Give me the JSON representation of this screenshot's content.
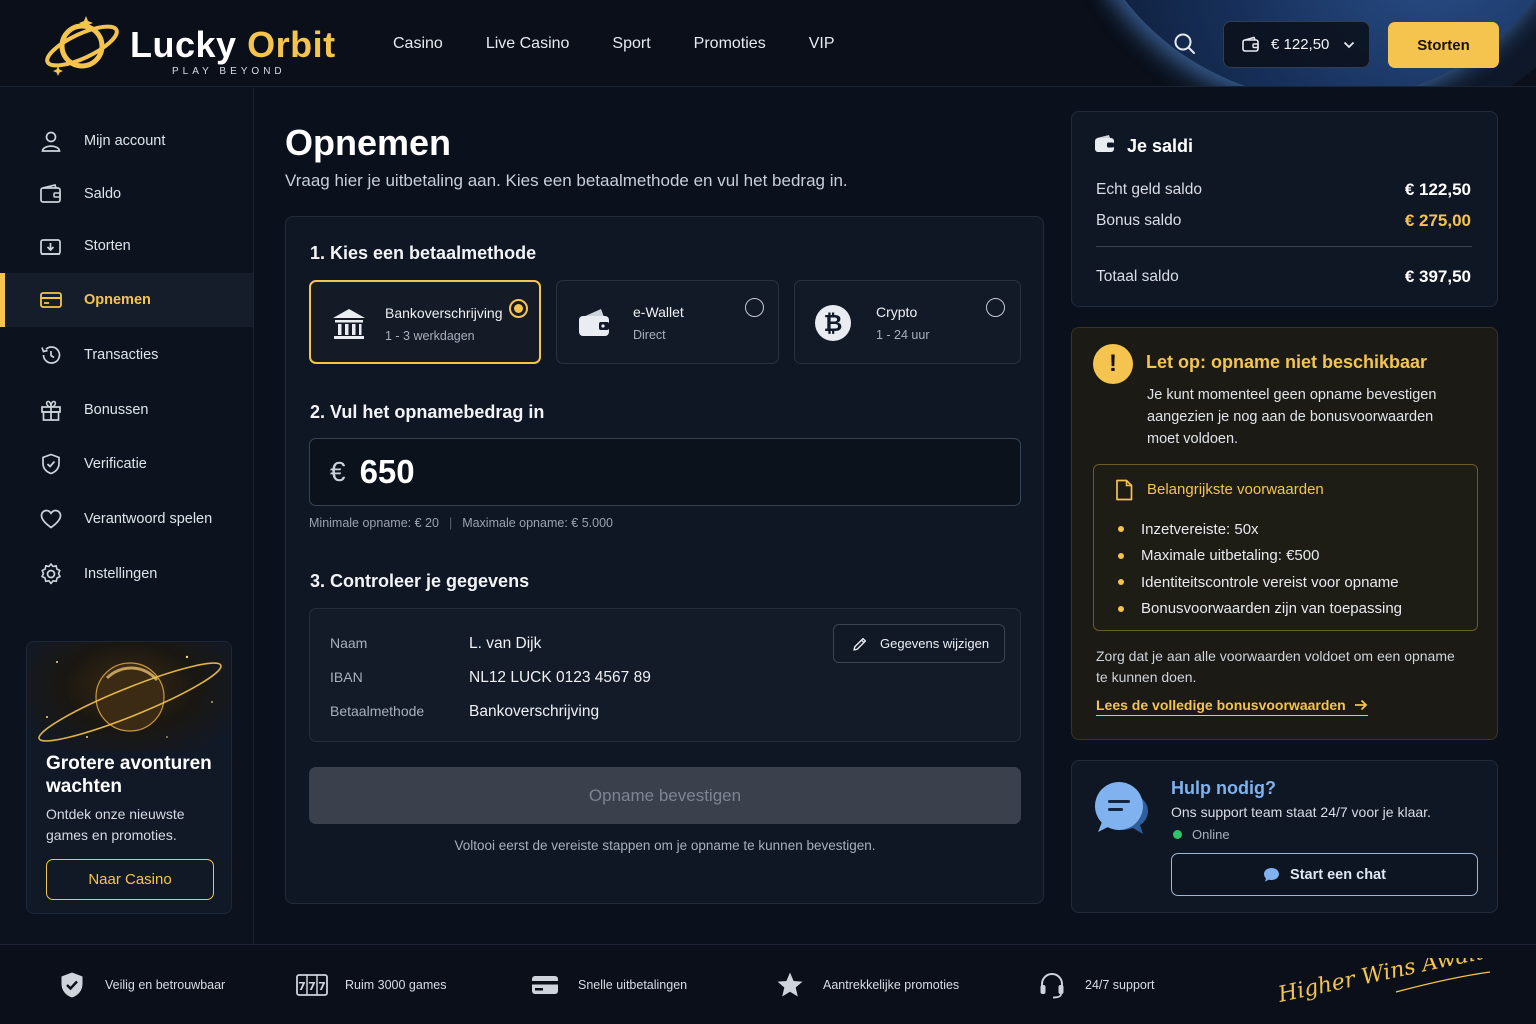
{
  "brand": {
    "name_part1": "Lucky",
    "name_part2": "Orbit",
    "tagline": "PLAY BEYOND",
    "accent_color": "#f4c44e"
  },
  "header": {
    "nav": [
      "Casino",
      "Live Casino",
      "Sport",
      "Promoties",
      "VIP"
    ],
    "balance": "€ 122,50",
    "deposit_label": "Storten"
  },
  "sidebar": {
    "items": [
      {
        "label": "Mijn account",
        "icon": "user-icon",
        "active": false
      },
      {
        "label": "Saldo",
        "icon": "wallet-icon",
        "active": false
      },
      {
        "label": "Storten",
        "icon": "deposit-icon",
        "active": false
      },
      {
        "label": "Opnemen",
        "icon": "card-icon",
        "active": true
      },
      {
        "label": "Transacties",
        "icon": "history-icon",
        "active": false
      },
      {
        "label": "Bonussen",
        "icon": "gift-icon",
        "active": false
      },
      {
        "label": "Verificatie",
        "icon": "shield-check-icon",
        "active": false
      },
      {
        "label": "Verantwoord spelen",
        "icon": "heart-icon",
        "active": false
      },
      {
        "label": "Instellingen",
        "icon": "gear-icon",
        "active": false
      }
    ],
    "promo": {
      "title": "Grotere avonturen wachten",
      "text": "Ontdek onze nieuwste games en promoties.",
      "button": "Naar Casino"
    }
  },
  "main": {
    "title": "Opnemen",
    "subtitle": "Vraag hier je uitbetaling aan. Kies een betaalmethode en vul het bedrag in.",
    "step1": {
      "title": "1.  Kies een betaalmethode",
      "methods": [
        {
          "name": "Bankoverschrijving",
          "sub": "1 - 3 werkdagen",
          "icon": "bank-icon",
          "selected": true
        },
        {
          "name": "e-Wallet",
          "sub": "Direct",
          "icon": "wallet-icon",
          "selected": false
        },
        {
          "name": "Crypto",
          "sub": "1 - 24 uur",
          "icon": "bitcoin-icon",
          "selected": false
        }
      ]
    },
    "step2": {
      "title": "2. Vul het opnamebedrag in",
      "currency": "€",
      "amount": "650",
      "min_label": "Minimale opname: € 20",
      "max_label": "Maximale opname: € 5.000"
    },
    "step3": {
      "title": "3. Controleer je gegevens",
      "rows": [
        {
          "label": "Naam",
          "value": "L. van Dijk"
        },
        {
          "label": "IBAN",
          "value": "NL12 LUCK 0123 4567 89"
        },
        {
          "label": "Betaalmethode",
          "value": "Bankoverschrijving"
        }
      ],
      "edit_label": "Gegevens wijzigen"
    },
    "confirm_label": "Opname bevestigen",
    "confirm_note": "Voltooi eerst de vereiste stappen om je opname te kunnen bevestigen."
  },
  "saldi": {
    "title": "Je saldi",
    "rows": [
      {
        "label": "Echt geld saldo",
        "value": "€ 122,50"
      },
      {
        "label": "Bonus saldo",
        "value": "€ 275,00"
      }
    ],
    "total_label": "Totaal saldo",
    "total_value": "€ 397,50"
  },
  "warning": {
    "title": "Let op: opname niet beschikbaar",
    "text": "Je kunt momenteel geen opname bevestigen aangezien je nog aan de bonusvoorwaarden moet voldoen.",
    "terms_title": "Belangrijkste voorwaarden",
    "terms": [
      "Inzetvereiste: 50x",
      "Maximale uitbetaling: €500",
      "Identiteitscontrole vereist voor opname",
      "Bonusvoorwaarden zijn van toepassing"
    ],
    "footer_text": "Zorg dat je aan alle voorwaarden voldoet om een opname te kunnen doen.",
    "link_label": "Lees de volledige bonusvoorwaarden"
  },
  "help": {
    "title": "Hulp nodig?",
    "subtitle": "Ons support team staat 24/7 voor je klaar.",
    "status": "Online",
    "button": "Start een chat"
  },
  "footer": {
    "items": [
      {
        "label": "Veilig en betrouwbaar",
        "icon": "shield-icon"
      },
      {
        "label": "Ruim 3000 games",
        "icon": "slot-machine-icon"
      },
      {
        "label": "Snelle uitbetalingen",
        "icon": "card-icon"
      },
      {
        "label": "Aantrekkelijke promoties",
        "icon": "star-icon"
      },
      {
        "label": "24/7 support",
        "icon": "headset-icon"
      }
    ],
    "signature": "Higher Wins Await"
  }
}
